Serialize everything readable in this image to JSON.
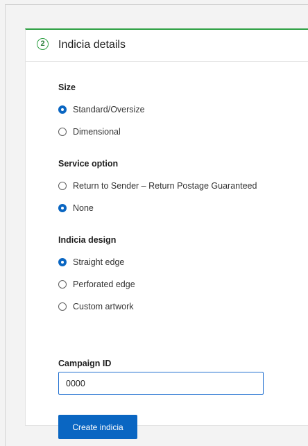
{
  "step": {
    "number": "2",
    "title": "Indicia details"
  },
  "size": {
    "label": "Size",
    "options": [
      {
        "label": "Standard/Oversize",
        "checked": true
      },
      {
        "label": "Dimensional",
        "checked": false
      }
    ]
  },
  "service_option": {
    "label": "Service option",
    "options": [
      {
        "label": "Return to Sender – Return Postage Guaranteed",
        "checked": false
      },
      {
        "label": "None",
        "checked": true
      }
    ]
  },
  "indicia_design": {
    "label": "Indicia design",
    "options": [
      {
        "label": "Straight edge",
        "checked": true
      },
      {
        "label": "Perforated edge",
        "checked": false
      },
      {
        "label": "Custom artwork",
        "checked": false
      }
    ]
  },
  "campaign_id": {
    "label": "Campaign ID",
    "value": "0000"
  },
  "actions": {
    "create_label": "Create indicia"
  },
  "colors": {
    "accent": "#0a66c2",
    "step_border": "#2ea043"
  }
}
